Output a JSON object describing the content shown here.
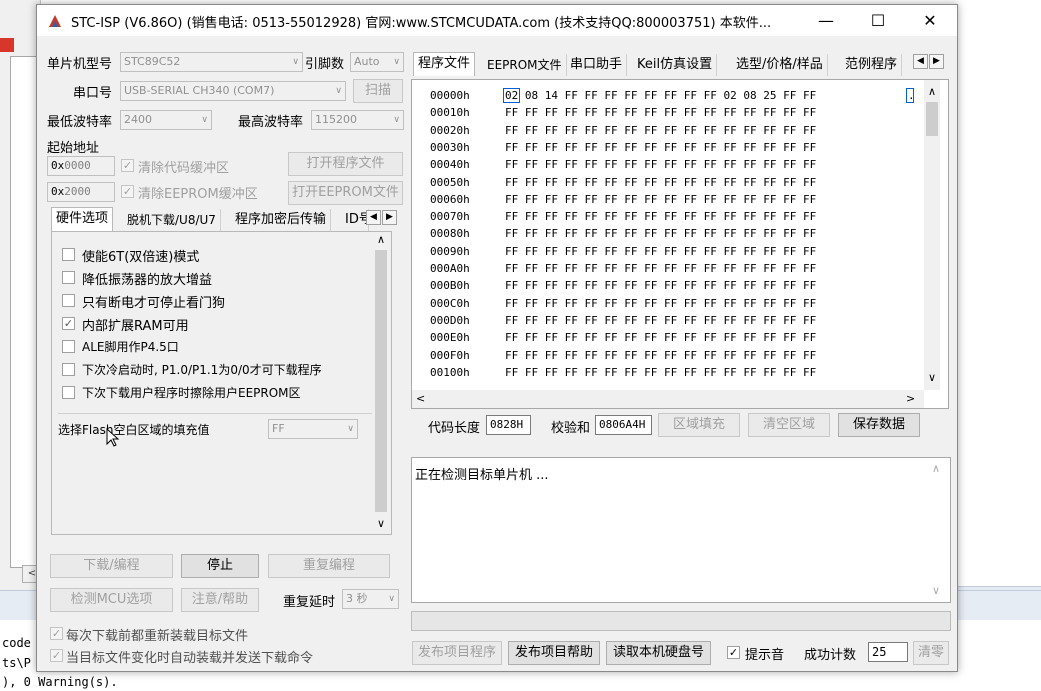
{
  "window": {
    "title": "STC-ISP (V6.86O) (销售电话: 0513-55012928) 官网:www.STCMCUDATA.com  (技术支持QQ:800003751) 本软件...",
    "min_glyph": "—",
    "max_glyph": "☐",
    "close_glyph": "✕"
  },
  "left": {
    "mcu_type_label": "单片机型号",
    "mcu_type_value": "STC89C52",
    "pin_count_label": "引脚数",
    "pin_count_value": "Auto",
    "port_label": "串口号",
    "port_value": "USB-SERIAL CH340 (COM7)",
    "scan_button": "扫描",
    "min_baud_label": "最低波特率",
    "min_baud_value": "2400",
    "max_baud_label": "最高波特率",
    "max_baud_value": "115200",
    "start_addr_label": "起始地址",
    "addr1_prefix": "0x",
    "addr1_value": "0000",
    "clear_code_label": "清除代码缓冲区",
    "open_program_button": "打开程序文件",
    "addr2_prefix": "0x",
    "addr2_value": "2000",
    "clear_eeprom_label": "清除EEPROM缓冲区",
    "open_eeprom_button": "打开EEPROM文件",
    "tabs": [
      "硬件选项",
      "脱机下载/U8/U7",
      "程序加密后传输",
      "ID号"
    ],
    "options": [
      {
        "label": "使能6T(双倍速)模式",
        "checked": false
      },
      {
        "label": "降低振荡器的放大增益",
        "checked": false
      },
      {
        "label": "只有断电才可停止看门狗",
        "checked": false
      },
      {
        "label": "内部扩展RAM可用",
        "checked": true
      },
      {
        "label": "ALE脚用作P4.5口",
        "checked": false
      },
      {
        "label": "下次冷启动时, P1.0/P1.1为0/0才可下载程序",
        "checked": false
      },
      {
        "label": "下次下载用户程序时擦除用户EEPROM区",
        "checked": false
      }
    ],
    "fill_label": "选择Flash空白区域的填充值",
    "fill_value": "FF",
    "download_button": "下载/编程",
    "stop_button": "停止",
    "reprogram_button": "重复编程",
    "detect_button": "检测MCU选项",
    "help_button": "注意/帮助",
    "retry_delay_label": "重复延时",
    "retry_delay_value": "3 秒",
    "reload_each_label": "每次下载前都重新装载目标文件",
    "auto_reload_label": "当目标文件变化时自动装载并发送下载命令"
  },
  "right": {
    "tabs": [
      "程序文件",
      "EEPROM文件",
      "串口助手",
      "Keil仿真设置",
      "选型/价格/样品",
      "范例程序"
    ],
    "hex_rows": [
      {
        "addr": "00000h",
        "bytes": "02 08 14 FF FF FF FF FF FF FF FF 02 08 25 FF FF",
        "ascii": "."
      },
      {
        "addr": "00010h",
        "bytes": "FF FF FF FF FF FF FF FF FF FF FF FF FF FF FF FF",
        "ascii": ""
      },
      {
        "addr": "00020h",
        "bytes": "FF FF FF FF FF FF FF FF FF FF FF FF FF FF FF FF",
        "ascii": ""
      },
      {
        "addr": "00030h",
        "bytes": "FF FF FF FF FF FF FF FF FF FF FF FF FF FF FF FF",
        "ascii": ""
      },
      {
        "addr": "00040h",
        "bytes": "FF FF FF FF FF FF FF FF FF FF FF FF FF FF FF FF",
        "ascii": ""
      },
      {
        "addr": "00050h",
        "bytes": "FF FF FF FF FF FF FF FF FF FF FF FF FF FF FF FF",
        "ascii": ""
      },
      {
        "addr": "00060h",
        "bytes": "FF FF FF FF FF FF FF FF FF FF FF FF FF FF FF FF",
        "ascii": ""
      },
      {
        "addr": "00070h",
        "bytes": "FF FF FF FF FF FF FF FF FF FF FF FF FF FF FF FF",
        "ascii": ""
      },
      {
        "addr": "00080h",
        "bytes": "FF FF FF FF FF FF FF FF FF FF FF FF FF FF FF FF",
        "ascii": ""
      },
      {
        "addr": "00090h",
        "bytes": "FF FF FF FF FF FF FF FF FF FF FF FF FF FF FF FF",
        "ascii": ""
      },
      {
        "addr": "000A0h",
        "bytes": "FF FF FF FF FF FF FF FF FF FF FF FF FF FF FF FF",
        "ascii": ""
      },
      {
        "addr": "000B0h",
        "bytes": "FF FF FF FF FF FF FF FF FF FF FF FF FF FF FF FF",
        "ascii": ""
      },
      {
        "addr": "000C0h",
        "bytes": "FF FF FF FF FF FF FF FF FF FF FF FF FF FF FF FF",
        "ascii": ""
      },
      {
        "addr": "000D0h",
        "bytes": "FF FF FF FF FF FF FF FF FF FF FF FF FF FF FF FF",
        "ascii": ""
      },
      {
        "addr": "000E0h",
        "bytes": "FF FF FF FF FF FF FF FF FF FF FF FF FF FF FF FF",
        "ascii": ""
      },
      {
        "addr": "000F0h",
        "bytes": "FF FF FF FF FF FF FF FF FF FF FF FF FF FF FF FF",
        "ascii": ""
      },
      {
        "addr": "00100h",
        "bytes": "FF FF FF FF FF FF FF FF FF FF FF FF FF FF FF FF",
        "ascii": ""
      }
    ],
    "code_length_label": "代码长度",
    "code_length_value": "0828H",
    "checksum_label": "校验和",
    "checksum_value": "0806A4H",
    "fill_region_button": "区域填充",
    "clear_region_button": "清空区域",
    "save_data_button": "保存数据",
    "log_text": "正在检测目标单片机 ...",
    "publish_program_button": "发布项目程序",
    "publish_help_button": "发布项目帮助",
    "read_disk_button": "读取本机硬盘号",
    "beep_label": "提示音",
    "success_count_label": "成功计数",
    "success_count_value": "25",
    "clear_count_button": "清零"
  },
  "background": {
    "output_lines": [
      "code",
      "ts\\P",
      "), 0 Warning(s)."
    ]
  },
  "colors": {
    "accent": "#0078d7",
    "window_bg": "#f0f0f0",
    "disabled_text": "#a0a0a0"
  }
}
